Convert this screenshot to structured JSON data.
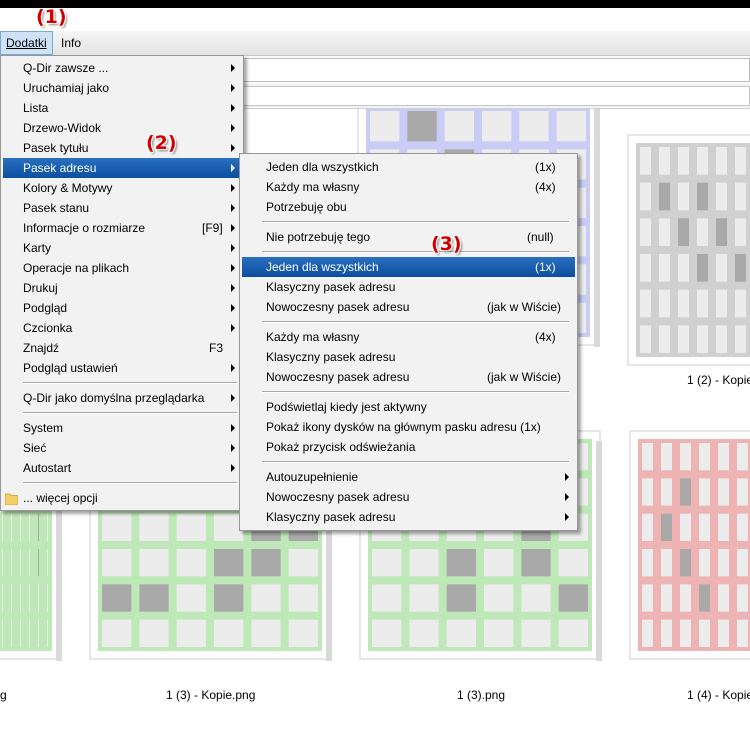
{
  "annotations": [
    "(1)",
    "(2)",
    "(3)"
  ],
  "menubar": {
    "items": [
      "Dodatki",
      "Info"
    ]
  },
  "main_menu": {
    "items": [
      {
        "label": "Q-Dir zawsze ...",
        "shortcut": "",
        "submenu": true
      },
      {
        "label": "Uruchamiaj jako",
        "shortcut": "",
        "submenu": true
      },
      {
        "label": "Lista",
        "shortcut": "",
        "submenu": true
      },
      {
        "label": "Drzewo-Widok",
        "shortcut": "",
        "submenu": true
      },
      {
        "label": "Pasek tytułu",
        "shortcut": "",
        "submenu": true
      },
      {
        "label": "Pasek adresu",
        "shortcut": "",
        "submenu": true
      },
      {
        "label": "Kolory & Motywy",
        "shortcut": "",
        "submenu": true
      },
      {
        "label": "Pasek stanu",
        "shortcut": "",
        "submenu": true
      },
      {
        "label": "Informacje o rozmiarze",
        "shortcut": "[F9]",
        "submenu": true
      },
      {
        "label": "Karty",
        "shortcut": "",
        "submenu": true
      },
      {
        "label": "Operacje na plikach",
        "shortcut": "",
        "submenu": true
      },
      {
        "label": "Drukuj",
        "shortcut": "",
        "submenu": true
      },
      {
        "label": "Podgląd",
        "shortcut": "",
        "submenu": true
      },
      {
        "label": "Czcionka",
        "shortcut": "",
        "submenu": true
      },
      {
        "label": "Znajdź",
        "shortcut": "F3",
        "submenu": false
      },
      {
        "label": "Podgląd ustawień",
        "shortcut": "",
        "submenu": true
      },
      {
        "label": "Q-Dir jako domyślna przeglądarka",
        "shortcut": "",
        "submenu": true
      },
      {
        "label": "System",
        "shortcut": "",
        "submenu": true
      },
      {
        "label": "Sieć",
        "shortcut": "",
        "submenu": true
      },
      {
        "label": "Autostart",
        "shortcut": "",
        "submenu": true
      },
      {
        "label": "... więcej opcji",
        "shortcut": "",
        "submenu": false
      }
    ]
  },
  "submenu": {
    "items": [
      {
        "label": "Jeden dla wszystkich",
        "value": "(1x)",
        "submenu": false
      },
      {
        "label": "Każdy ma własny",
        "value": "(4x)",
        "submenu": false
      },
      {
        "label": "Potrzebuję obu",
        "value": "",
        "submenu": false
      },
      {
        "label": "Nie potrzebuję tego",
        "value": "(null)",
        "submenu": false
      },
      {
        "label": "Jeden dla wszystkich",
        "value": "(1x)",
        "submenu": false
      },
      {
        "label": "Klasyczny pasek adresu",
        "value": "",
        "submenu": false
      },
      {
        "label": "Nowoczesny pasek adresu",
        "value": "(jak w Wiście)",
        "submenu": false
      },
      {
        "label": "Każdy ma własny",
        "value": "(4x)",
        "submenu": false
      },
      {
        "label": "Klasyczny pasek adresu",
        "value": "",
        "submenu": false
      },
      {
        "label": "Nowoczesny pasek adresu",
        "value": "(jak w Wiście)",
        "submenu": false
      },
      {
        "label": "Podświetlaj kiedy jest aktywny",
        "value": "",
        "submenu": false
      },
      {
        "label": "Pokaż ikony dysków na głównym pasku adresu (1x)",
        "value": "",
        "submenu": false
      },
      {
        "label": "Pokaż przycisk odświeżania",
        "value": "",
        "submenu": false
      },
      {
        "label": "Autouzupełnienie",
        "value": "",
        "submenu": true
      },
      {
        "label": "Nowoczesny pasek adresu",
        "value": "",
        "submenu": true
      },
      {
        "label": "Klasyczny pasek adresu",
        "value": "",
        "submenu": true
      }
    ]
  },
  "files": [
    "1 (2) - Kopie",
    "1 (3) - Kopie.png",
    "1 (3).png",
    "1 (4) - Kopie",
    "g"
  ],
  "colors": {
    "annotation": "#d00000",
    "selection": "#0b4f9e",
    "thumb_blue": "#c9cdf5",
    "thumb_gray": "#d0d0d0",
    "thumb_green": "#bfe8b8",
    "thumb_red": "#eeb4b4"
  }
}
